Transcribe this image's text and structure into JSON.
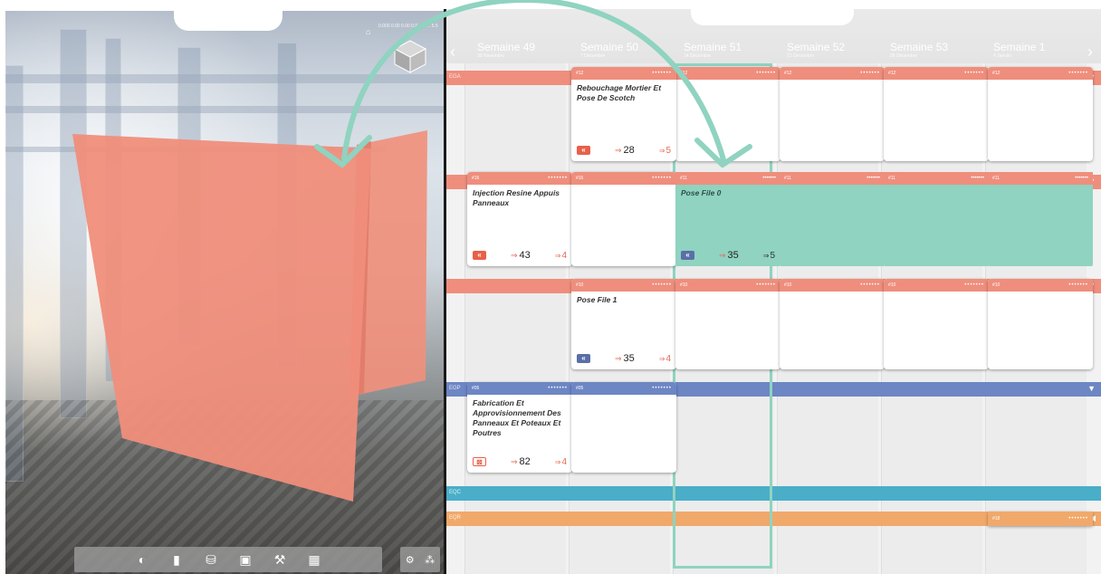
{
  "viewer": {
    "coord_readout": "0.000 0.00 0.00 0.0 -0.0 .. 5.5",
    "toolbar_icons": [
      "visibility-icon",
      "layers-icon",
      "bucket-icon",
      "clipboard-icon",
      "worker-icon",
      "grid-icon"
    ],
    "toolbar_right_icons": [
      "settings-icon",
      "hierarchy-icon"
    ]
  },
  "planning": {
    "weeks": [
      {
        "label": "Semaine 49",
        "sub": "30 Novembre"
      },
      {
        "label": "Semaine 50",
        "sub": "7 Décembre"
      },
      {
        "label": "Semaine 51",
        "sub": "14 Décembre"
      },
      {
        "label": "Semaine 52",
        "sub": "21 Décembre"
      },
      {
        "label": "Semaine 53",
        "sub": "28 Décembre"
      },
      {
        "label": "Semaine 1",
        "sub": "4 Janvier"
      }
    ],
    "lanes": [
      {
        "code": "EGA"
      },
      {
        "code": ""
      },
      {
        "code": ""
      },
      {
        "code": "EGP"
      },
      {
        "code": "EQC"
      },
      {
        "code": "EQR"
      }
    ],
    "cards": {
      "c1": {
        "id": "#12",
        "title": "Rebouchage Mortier Et Pose De Scotch",
        "tag": "«",
        "metric": "28",
        "count": "5"
      },
      "c2": {
        "id": "#16",
        "title": "Injection Resine Appuis Panneaux",
        "tag": "«",
        "metric": "43",
        "count": "4"
      },
      "c3": {
        "id": "#11",
        "title": "Pose File 0",
        "tag": "«",
        "metric": "35",
        "count": "5"
      },
      "c4": {
        "id": "#10",
        "title": "Pose File 1",
        "tag": "«",
        "metric": "35",
        "count": "4"
      },
      "c5": {
        "id": "#05",
        "title": "Fabrication Et Approvisionnement Des Panneaux Et Poteaux Et Poutres",
        "tag": "⊠",
        "metric": "82",
        "count": "4"
      }
    },
    "header_ids": {
      "r1": [
        "#12",
        "#12",
        "#12",
        "#12",
        "#12"
      ],
      "r2": [
        "#16",
        "#16",
        "#11",
        "#11",
        "#11",
        "#11"
      ],
      "r3": [
        "#10",
        "#10",
        "#10",
        "#10",
        "#10"
      ],
      "r4": [
        "#05",
        "#05"
      ],
      "r6": "#18"
    },
    "colors": {
      "salmon": "#ef8e7d",
      "teal": "#8fd3c0",
      "blue": "#6d86c4",
      "cyan": "#4aaec9",
      "orange": "#f0a96b"
    }
  }
}
